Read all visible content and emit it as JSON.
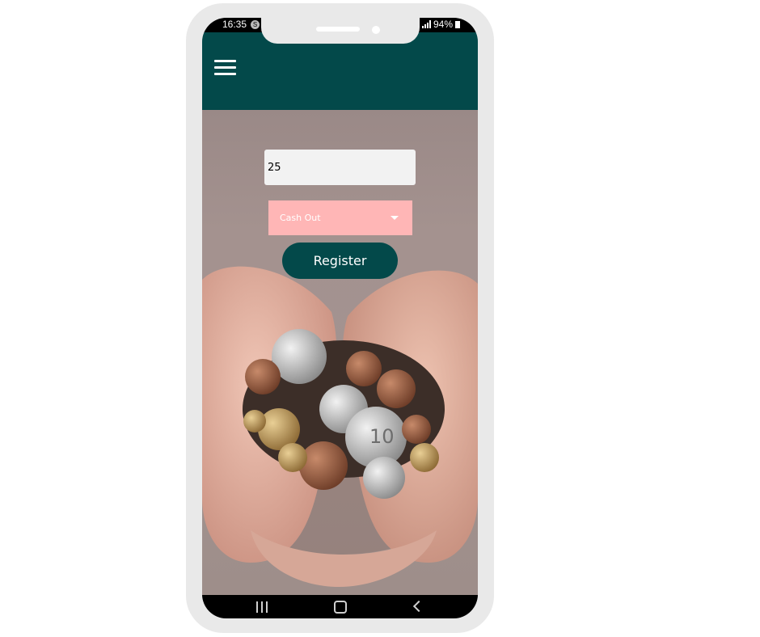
{
  "status_bar": {
    "time": "16:35",
    "notification_badge": "S",
    "battery": "94%"
  },
  "form": {
    "amount_value": "25",
    "transaction_type": "Cash Out",
    "register_label": "Register"
  },
  "colors": {
    "primary": "#03494a",
    "select_background": "#ffb6b6",
    "input_background": "#f2f2f2"
  },
  "icons": [
    "menu-icon",
    "chevron-down-icon",
    "nav-recents-icon",
    "nav-home-icon",
    "nav-back-icon"
  ]
}
